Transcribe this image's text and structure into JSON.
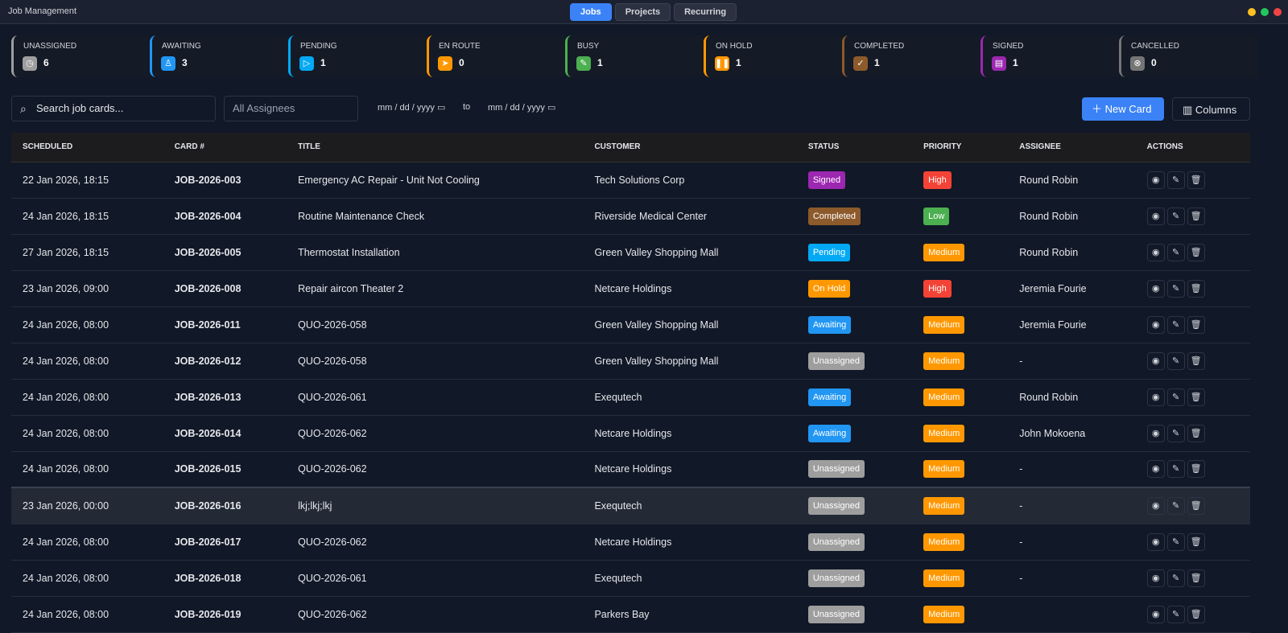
{
  "app": {
    "title": "Job Management",
    "tabs": [
      "Jobs",
      "Projects",
      "Recurring"
    ]
  },
  "stats": [
    {
      "label": "UNASSIGNED",
      "count": "6",
      "color": "#9e9e9e",
      "icon": "clock-icon",
      "glyph": "◷"
    },
    {
      "label": "AWAITING",
      "count": "3",
      "color": "#2196f3",
      "icon": "user-icon",
      "glyph": "♙"
    },
    {
      "label": "PENDING",
      "count": "1",
      "color": "#03a9f4",
      "icon": "play-icon",
      "glyph": "▷"
    },
    {
      "label": "EN ROUTE",
      "count": "0",
      "color": "#ff9800",
      "icon": "navigation-icon",
      "glyph": "➤"
    },
    {
      "label": "BUSY",
      "count": "1",
      "color": "#4caf50",
      "icon": "wrench-icon",
      "glyph": "✎"
    },
    {
      "label": "ON HOLD",
      "count": "1",
      "color": "#ff9800",
      "icon": "pause-icon",
      "glyph": "❚❚"
    },
    {
      "label": "COMPLETED",
      "count": "1",
      "color": "#8d5a2b",
      "icon": "check-circle-icon",
      "glyph": "✓"
    },
    {
      "label": "SIGNED",
      "count": "1",
      "color": "#9c27b0",
      "icon": "file-signed-icon",
      "glyph": "▤"
    },
    {
      "label": "CANCELLED",
      "count": "0",
      "color": "#757575",
      "icon": "x-circle-icon",
      "glyph": "⊗"
    }
  ],
  "toolbar": {
    "search_placeholder": "Search job cards...",
    "assignee": "All Assignees",
    "date_from": "mm / dd / yyyy",
    "to": "to",
    "date_to": "mm / dd / yyyy",
    "new_card": "New Card",
    "columns": "Columns"
  },
  "table": {
    "headers": [
      "SCHEDULED",
      "CARD #",
      "TITLE",
      "CUSTOMER",
      "STATUS",
      "PRIORITY",
      "ASSIGNEE",
      "ACTIONS"
    ],
    "rows": [
      [
        "22 Jan 2026, 18:15",
        "JOB-2026-003",
        "Emergency AC Repair - Unit Not Cooling",
        "Tech Solutions Corp",
        "Signed",
        "High",
        "Round Robin"
      ],
      [
        "24 Jan 2026, 18:15",
        "JOB-2026-004",
        "Routine Maintenance Check",
        "Riverside Medical Center",
        "Completed",
        "Low",
        "Round Robin"
      ],
      [
        "27 Jan 2026, 18:15",
        "JOB-2026-005",
        "Thermostat Installation",
        "Green Valley Shopping Mall",
        "Pending",
        "Medium",
        "Round Robin"
      ],
      [
        "23 Jan 2026, 09:00",
        "JOB-2026-008",
        "Repair aircon Theater 2",
        "Netcare Holdings",
        "On Hold",
        "High",
        "Jeremia Fourie"
      ],
      [
        "24 Jan 2026, 08:00",
        "JOB-2026-011",
        "QUO-2026-058",
        "Green Valley Shopping Mall",
        "Awaiting",
        "Medium",
        "Jeremia Fourie"
      ],
      [
        "24 Jan 2026, 08:00",
        "JOB-2026-012",
        "QUO-2026-058",
        "Green Valley Shopping Mall",
        "Unassigned",
        "Medium",
        "-"
      ],
      [
        "24 Jan 2026, 08:00",
        "JOB-2026-013",
        "QUO-2026-061",
        "Exequtech",
        "Awaiting",
        "Medium",
        "Round Robin"
      ],
      [
        "24 Jan 2026, 08:00",
        "JOB-2026-014",
        "QUO-2026-062",
        "Netcare Holdings",
        "Awaiting",
        "Medium",
        "John Mokoena"
      ],
      [
        "24 Jan 2026, 08:00",
        "JOB-2026-015",
        "QUO-2026-062",
        "Netcare Holdings",
        "Unassigned",
        "Medium",
        "-"
      ],
      [
        "23 Jan 2026, 00:00",
        "JOB-2026-016",
        "lkj;lkj;lkj",
        "Exequtech",
        "Unassigned",
        "Medium",
        "-"
      ],
      [
        "24 Jan 2026, 08:00",
        "JOB-2026-017",
        "QUO-2026-062",
        "Netcare Holdings",
        "Unassigned",
        "Medium",
        "-"
      ],
      [
        "24 Jan 2026, 08:00",
        "JOB-2026-018",
        "QUO-2026-061",
        "Exequtech",
        "Unassigned",
        "Medium",
        "-"
      ],
      [
        "24 Jan 2026, 08:00",
        "JOB-2026-019",
        "QUO-2026-062",
        "Parkers Bay",
        "Unassigned",
        "Medium",
        ""
      ]
    ]
  },
  "colors": {
    "Signed": "#9c27b0",
    "Completed": "#8d5a2b",
    "Pending": "#03a9f4",
    "On Hold": "#ff9800",
    "Awaiting": "#2196f3",
    "Unassigned": "#9e9e9e",
    "High": "#f44336",
    "Low": "#4caf50",
    "Medium": "#ff9800",
    "accent": "#3b82f6"
  }
}
